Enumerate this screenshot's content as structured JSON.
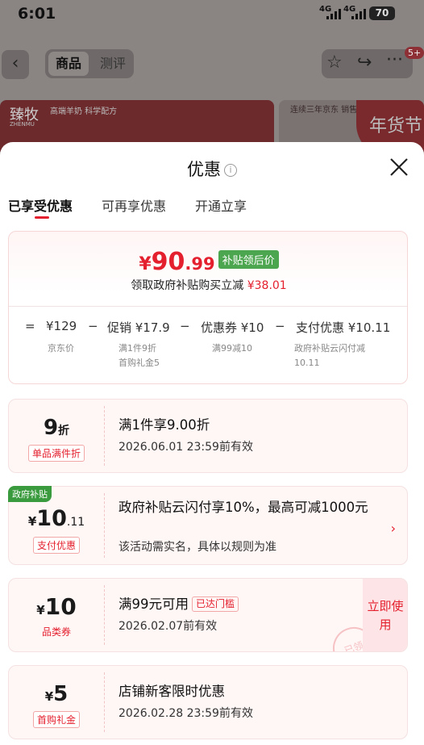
{
  "status_bar": {
    "time": "6:01",
    "signal1": "4G",
    "signal2": "4G",
    "battery": "70"
  },
  "nav": {
    "tab_goods": "商品",
    "tab_review": "测评",
    "badge": "5+"
  },
  "banner": {
    "brand": "臻牧",
    "brand_en": "ZHENMU",
    "slogan": "高端羊奶 科学配方",
    "right_text": "连续三年京东 销售额第一",
    "right_big": "年货节"
  },
  "sheet": {
    "title": "优惠",
    "info": "i",
    "tabs": [
      {
        "label": "已享受优惠"
      },
      {
        "label": "可再享优惠"
      },
      {
        "label": "开通立享"
      }
    ],
    "summary": {
      "yen": "¥",
      "price_int": "90",
      "price_dec": ".99",
      "tag": "补贴领后价",
      "subtitle": "领取政府补贴购买立减",
      "subtitle_amount": "¥38.01",
      "eq": "=",
      "minus": "−",
      "items": [
        {
          "value": "¥129",
          "desc": "京东价",
          "desc2": ""
        },
        {
          "value": "促销 ¥17.9",
          "desc": "满1件9折",
          "desc2": "首购礼金5"
        },
        {
          "value": "优惠券 ¥10",
          "desc": "满99减10",
          "desc2": ""
        },
        {
          "value": "支付优惠 ¥10.11",
          "desc": "政府补贴云闪付减",
          "desc2": "10.11"
        }
      ]
    },
    "coupons": [
      {
        "amount_big": "9",
        "amount_small": "折",
        "label": "单品满件折",
        "title": "满1件享9.00折",
        "desc": "2026.06.01 23:59前有效"
      },
      {
        "tag": "政府补贴",
        "amount_yen": "¥",
        "amount_big": "10",
        "amount_small": ".11",
        "label": "支付优惠",
        "title": "政府补贴云闪付享10%，最高可减1000元",
        "desc": "该活动需实名，具体以规则为准",
        "chevron": "›"
      },
      {
        "amount_yen": "¥",
        "amount_big": "10",
        "label": "品类券",
        "title": "满99元可用",
        "badge": "已达门槛",
        "desc": "2026.02.07前有效",
        "button": "立即使用",
        "stamp": "已领"
      },
      {
        "amount_yen": "¥",
        "amount_big": "5",
        "label": "首购礼金",
        "title": "店铺新客限时优惠",
        "desc": "2026.02.28 23:59前有效"
      }
    ]
  }
}
